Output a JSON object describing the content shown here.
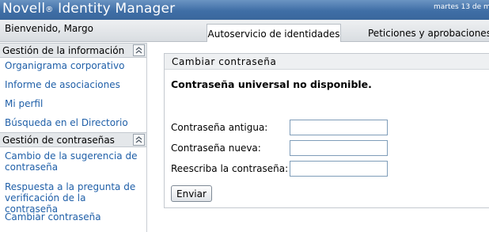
{
  "header": {
    "brand_name": "Novell",
    "brand_reg": "®",
    "brand_product": " Identity Manager",
    "date_text": "martes 13 de m"
  },
  "subbar": {
    "welcome": "Bienvenido, Margo",
    "tabs": [
      {
        "label": "Autoservicio de identidades",
        "active": true
      },
      {
        "label": "Peticiones y aprobaciones",
        "active": false
      }
    ]
  },
  "sidebar": {
    "sections": [
      {
        "title": "Gestión de la información",
        "items": [
          {
            "label": "Organigrama corporativo"
          },
          {
            "label": "Informe de asociaciones"
          },
          {
            "label": "Mi perfil"
          },
          {
            "label": "Búsqueda en el Directorio"
          }
        ]
      },
      {
        "title": "Gestión de contraseñas",
        "items": [
          {
            "label": "Cambio de la sugerencia de contraseña"
          },
          {
            "label": "Respuesta a la pregunta de verificación de la contraseña"
          },
          {
            "label": "Cambiar contraseña"
          }
        ]
      }
    ]
  },
  "panel": {
    "title": "Cambiar contraseña",
    "message": "Contraseña universal no disponible.",
    "fields": [
      {
        "label": "Contraseña antigua:",
        "value": ""
      },
      {
        "label": "Contraseña nueva:",
        "value": ""
      },
      {
        "label": "Reescriba la contraseña:",
        "value": ""
      }
    ],
    "submit_label": "Enviar"
  },
  "colors": {
    "header_blue": "#3f6ea6",
    "link_blue": "#1f5fa8",
    "section_gray": "#e4e7ea"
  }
}
